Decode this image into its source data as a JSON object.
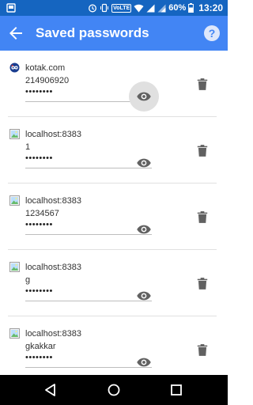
{
  "status_bar": {
    "volte": "VoLTE",
    "battery_percent": "60%",
    "time": "13:20"
  },
  "toolbar": {
    "title": "Saved passwords",
    "help_icon_glyph": "?"
  },
  "entries": [
    {
      "origin": "kotak.com",
      "username": "214906920",
      "password": "••••••••",
      "icon": "kotak-site-icon",
      "eye_pressed": true
    },
    {
      "origin": "localhost:8383",
      "username": "1",
      "password": "••••••••",
      "icon": "generic-site-icon",
      "eye_pressed": false
    },
    {
      "origin": "localhost:8383",
      "username": "1234567",
      "password": "••••••••",
      "icon": "generic-site-icon",
      "eye_pressed": false
    },
    {
      "origin": "localhost:8383",
      "username": "g",
      "password": "••••••••",
      "icon": "generic-site-icon",
      "eye_pressed": false
    },
    {
      "origin": "localhost:8383",
      "username": "gkakkar",
      "password": "••••••••",
      "icon": "generic-site-icon",
      "eye_pressed": false
    }
  ],
  "colors": {
    "status_bar": "#1565c0",
    "toolbar": "#4285f4",
    "icon_gray": "#616161"
  }
}
